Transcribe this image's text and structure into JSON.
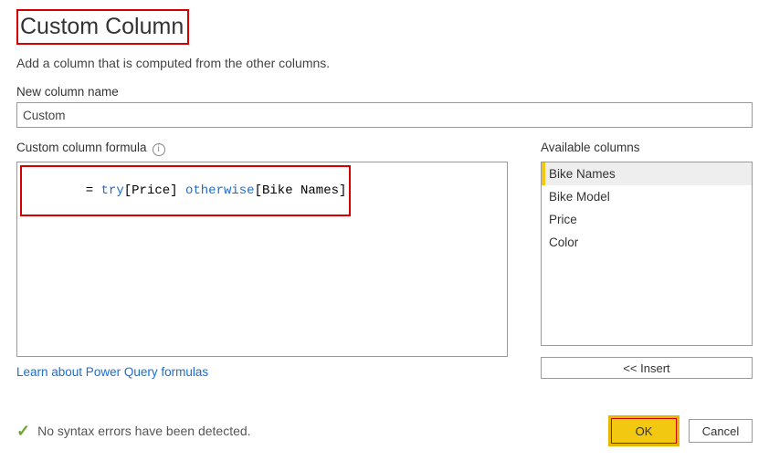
{
  "dialog": {
    "title": "Custom Column",
    "subtitle": "Add a column that is computed from the other columns."
  },
  "newColumn": {
    "label": "New column name",
    "value": "Custom"
  },
  "formula": {
    "label": "Custom column formula",
    "prefix": "= ",
    "kw1": "try",
    "seg1": "[Price] ",
    "kw2": "otherwise",
    "seg2": "[Bike Names]"
  },
  "available": {
    "label": "Available columns",
    "items": [
      "Bike Names",
      "Bike Model",
      "Price",
      "Color"
    ],
    "selectedIndex": 0,
    "insertLabel": "<< Insert"
  },
  "link": {
    "text": "Learn about Power Query formulas"
  },
  "status": {
    "text": "No syntax errors have been detected."
  },
  "buttons": {
    "ok": "OK",
    "cancel": "Cancel"
  }
}
